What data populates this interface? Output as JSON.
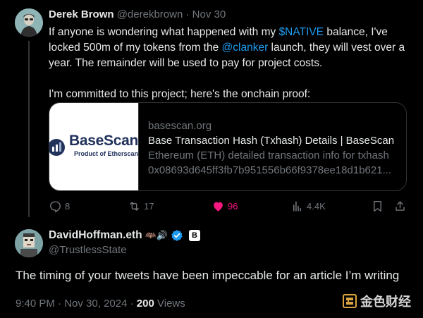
{
  "tweet1": {
    "display_name": "Derek Brown",
    "handle": "@derekbrown",
    "dot": "·",
    "date": "Nov 30",
    "text_part1": "If anyone is wondering what happened with my ",
    "cashtag": "$NATIVE",
    "text_part2": " balance, I've locked 500m of my tokens from the ",
    "mention": "@clanker",
    "text_part3": " launch, they will vest over a year. The remainder will be used to pay for project costs.",
    "text_para2": "I'm committed to this project; here's the onchain proof:",
    "card": {
      "logo_name": "BaseScan",
      "logo_sub": "Product of Etherscan",
      "domain": "basescan.org",
      "title": "Base Transaction Hash (Txhash) Details | BaseScan",
      "description": "Ethereum (ETH) detailed transaction info for txhash",
      "hash": "0x08693d645ff3fb7b951556b66f9378ee18d1b621..."
    },
    "actions": {
      "replies": "8",
      "reposts": "17",
      "likes": "96",
      "views": "4.4K"
    }
  },
  "tweet2": {
    "display_name": "DavidHoffman.eth",
    "name_emoji": "🦇🔊",
    "badge_letter": "B",
    "handle": "@TrustlessState",
    "text": "The timing of your tweets have been impeccable for an article I’m writing",
    "time": "9:40 PM",
    "dot": "·",
    "date": "Nov 30, 2024",
    "views_count": "200",
    "views_label": "Views"
  },
  "watermark": {
    "text": "金色财经"
  },
  "colors": {
    "link": "#1d9bf0",
    "like": "#f91880",
    "verified": "#1d9bf0",
    "muted": "#71767b"
  }
}
